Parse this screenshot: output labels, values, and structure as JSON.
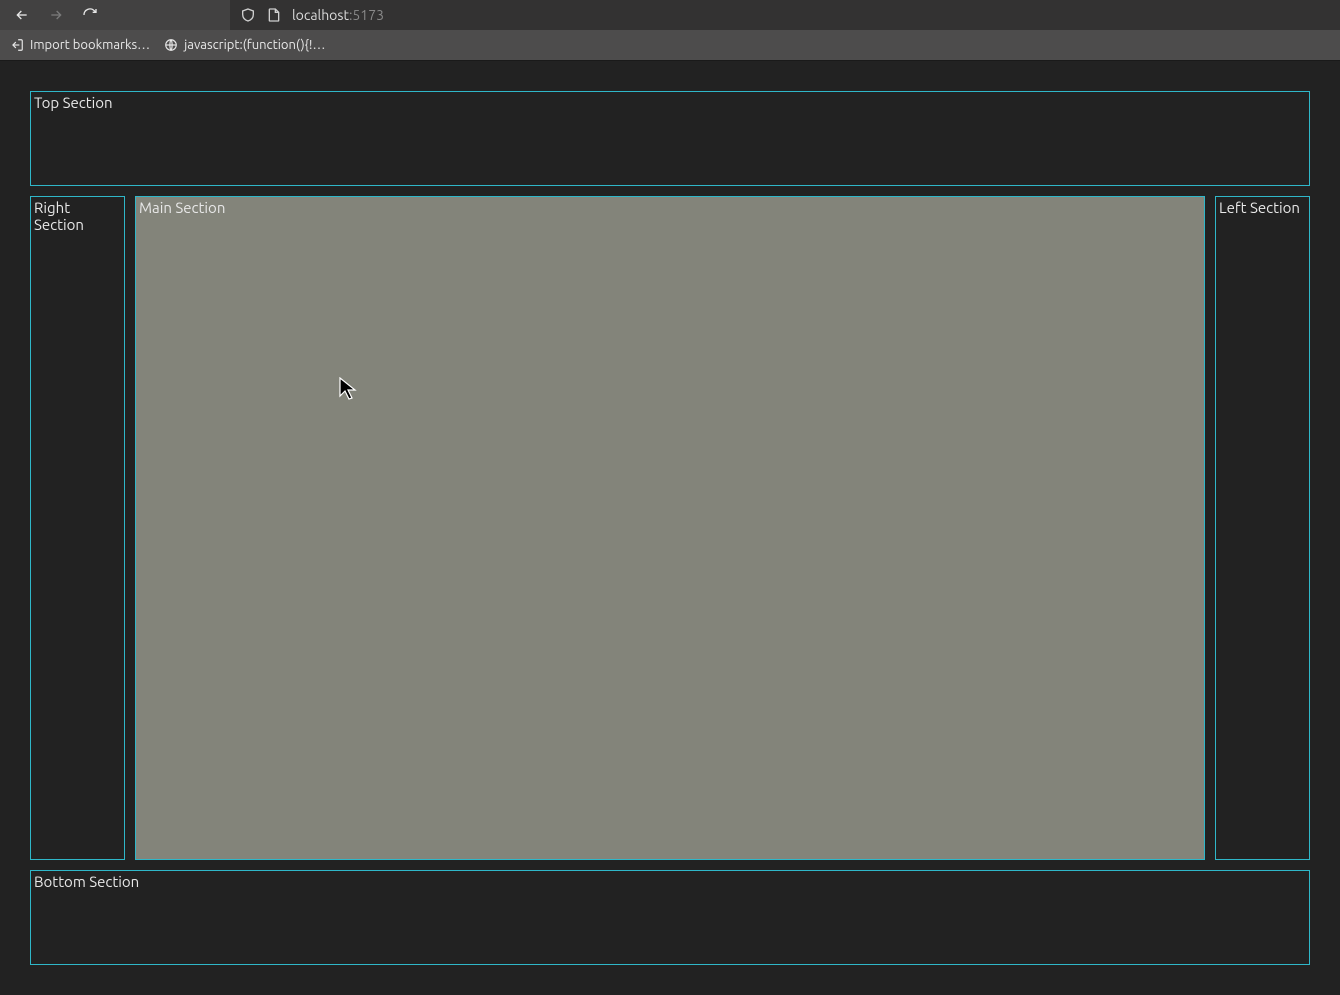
{
  "browser": {
    "url_host": "localhost",
    "url_port": ":5173",
    "bookmarks": {
      "import_label": "Import bookmarks…",
      "js_label": "javascript:(function(){!…"
    }
  },
  "sections": {
    "top": "Top Section",
    "right": "Right Section",
    "main": "Main Section",
    "left": "Left Section",
    "bottom": "Bottom Section"
  }
}
